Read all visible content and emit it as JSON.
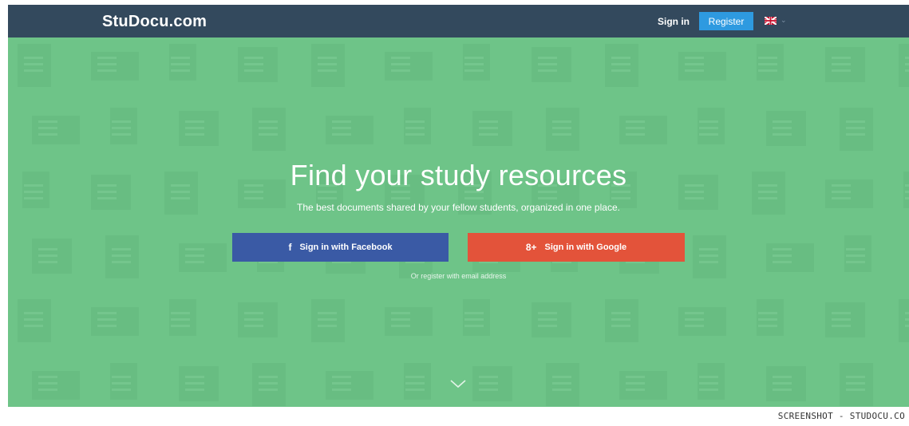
{
  "navbar": {
    "logo": "StuDocu.com",
    "signin_label": "Sign in",
    "register_label": "Register",
    "language_icon": "uk-flag-icon"
  },
  "hero": {
    "headline": "Find your study resources",
    "subheadline": "The best documents shared by your fellow students, organized in one place.",
    "facebook_button": {
      "icon": "f",
      "label": "Sign in with Facebook"
    },
    "google_button": {
      "icon": "8+",
      "label": "Sign in with Google"
    },
    "email_link": "Or register with email address",
    "scroll_icon": "chevron-down-icon"
  },
  "caption": "SCREENSHOT - STUDOCU.CO",
  "colors": {
    "navbar": "#33495d",
    "hero": "#6ec488",
    "register": "#2e9ae0",
    "facebook": "#3a5aa5",
    "google": "#e3533a"
  }
}
